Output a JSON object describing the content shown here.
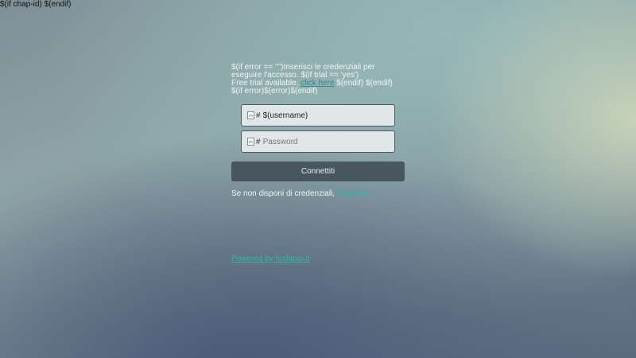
{
  "top_note": "$(if chap-id) $(endif)",
  "info": {
    "line1": "$(if error == \"\")Inserisci le credenziali per eseguire l'accesso. $(if trial == 'yes')",
    "line2_prefix": "Free trial available, ",
    "trial_link": "click here",
    "line2_suffix": " $(endif) $(endif) $(if error)$(error)$(endif)"
  },
  "username": {
    "icon_alt": "#",
    "value": "$(username)"
  },
  "password": {
    "icon_alt": "#",
    "placeholder": "Password"
  },
  "connect_label": "Connettiti",
  "register": {
    "prefix": "Se non disponi di credenziali, ",
    "link": "Registrati"
  },
  "powered_by": "Powered by fosfabio.it"
}
